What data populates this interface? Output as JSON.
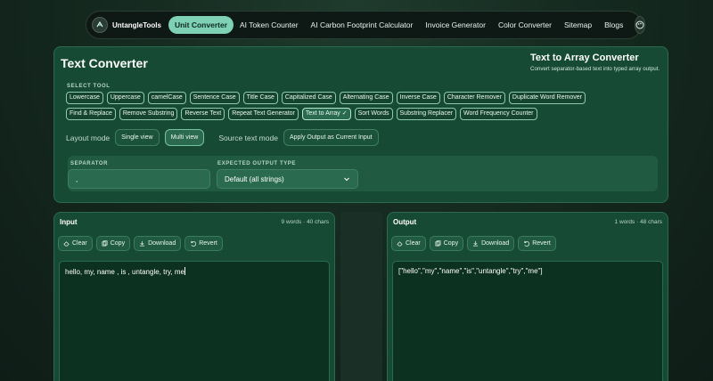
{
  "nav": {
    "brand": "UntangleTools",
    "items": [
      "Unit Converter",
      "AI Token Counter",
      "AI Carbon Footprint Calculator",
      "Invoice Generator",
      "Color Converter",
      "Sitemap",
      "Blogs"
    ],
    "active_index": 0
  },
  "card": {
    "title": "Text Converter",
    "subtitle": "Text to Array Converter",
    "description": "Convert separator-based text into typed array output.",
    "select_tool_label": "SELECT TOOL",
    "tools": [
      "Lowercase",
      "Uppercase",
      "camelCase",
      "Sentence Case",
      "Title Case",
      "Capitalized Case",
      "Alternating Case",
      "Inverse Case",
      "Character Remover",
      "Duplicate Word Remover",
      "Find & Replace",
      "Remove Substring",
      "Reverse Text",
      "Repeat Text Generator",
      "Text to Array",
      "Sort Words",
      "Substring Replacer",
      "Word Frequency Counter"
    ],
    "active_tool": "Text to Array",
    "layout_mode_label": "Layout mode",
    "layout_options": [
      "Single view",
      "Multi view"
    ],
    "layout_active": "Multi view",
    "source_mode_label": "Source text mode",
    "apply_button": "Apply Output as Current Input",
    "separator_label": "SEPARATOR",
    "separator_value": ",",
    "output_type_label": "EXPECTED OUTPUT TYPE",
    "output_type_value": "Default (all strings)"
  },
  "input_panel": {
    "title": "Input",
    "stats": "9 words · 40 chars",
    "actions": [
      "Clear",
      "Copy",
      "Download",
      "Revert"
    ],
    "text": "hello, my, name , is , untangle, try, me"
  },
  "output_panel": {
    "title": "Output",
    "stats": "1 words · 48 chars",
    "actions": [
      "Clear",
      "Copy",
      "Download",
      "Revert"
    ],
    "text": "[\"hello\",\"my\",\"name\",\"is\",\"untangle\",\"try\",\"me\"]"
  },
  "colors": {
    "accent": "#7ed1b4",
    "card_bg": "#164a34",
    "page_bg": "#152a20"
  }
}
